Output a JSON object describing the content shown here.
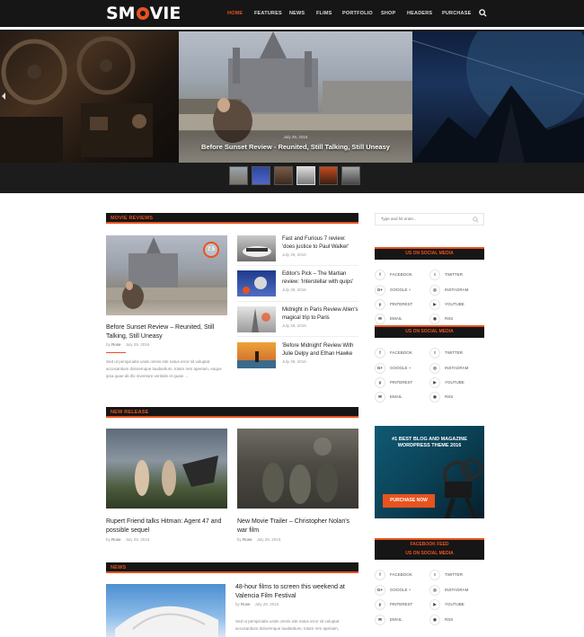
{
  "header": {
    "logo_left": "SM",
    "logo_right": "VIE",
    "nav": [
      "HOME",
      "FEATURES",
      "NEWS",
      "FLIMS",
      "PORTFOLIO",
      "SHOP",
      "HEADERS",
      "PURCHASE"
    ],
    "active_nav": "HOME",
    "search_icon": "search-icon"
  },
  "hero": {
    "date": "July 29, 2016",
    "title": "Before Sunset Review - Reunited, Still Talking, Still Uneasy"
  },
  "movie_reviews": {
    "heading": "MOVIE REVIEWS",
    "featured": {
      "title": "Before Sunset Review – Reunited, Still Talking, Still Uneasy",
      "author_prefix": "by",
      "author": "Rose",
      "date": "July 29, 2016",
      "rating": "7.5",
      "excerpt": "Sed ut perspiciatis unde omnis iste natus error sit voluptat accusantium doloremque laudantium, totam rem aperiam, eaque ipsa quae ab illo inventore veritatis et quasi …"
    },
    "list": [
      {
        "title": "Fast and Furious 7 review: 'does justice to Paul Walker'",
        "date": "July 29, 2016"
      },
      {
        "title": "Editor's Pick – The Martian review: 'Interstellar with quips'",
        "date": "July 29, 2016"
      },
      {
        "title": "Midnight in Paris Review Allen's magical trip to Paris",
        "date": "July 29, 2016"
      },
      {
        "title": "'Before Midnight' Review With Julie Delpy and Ethan Hawke",
        "date": "July 29, 2016"
      }
    ]
  },
  "new_release": {
    "heading": "NEW RELEASE",
    "items": [
      {
        "title": "Rupert Friend talks Hitman: Agent 47 and possible sequel",
        "author": "Rose",
        "date": "July 29, 2016"
      },
      {
        "title": "New Movie Trailer – Christopher Nolan's war film",
        "author": "Rose",
        "date": "July 29, 2016"
      }
    ]
  },
  "news": {
    "heading": "NEWS",
    "item": {
      "title": "48-hour films to screen this weekend at Valencia Film Festival",
      "author": "Rose",
      "date": "July 29, 2016",
      "excerpt": "Sed ut perspiciatis unde omnis iste natus error sit voluptat accusantium doloremque laudantium, totam rem aperiam,"
    }
  },
  "sidebar": {
    "search_placeholder": "Type and hit enter...",
    "social_heading": "US ON SOCIAL MEDIA",
    "social_left": [
      "FACEBOOK",
      "GOOGLE +",
      "PINTEREST",
      "EMAIL"
    ],
    "social_right": [
      "TWITTER",
      "INSTAGRAM",
      "YOUTUBE",
      "RSS"
    ],
    "promo": {
      "line1": "#1 BEST BLOG AND MAGAZINE",
      "line2": "WORDPRESS THEME 2016",
      "button": "PURCHASE NOW"
    },
    "feed_heading": "FACEBOOK FEED"
  },
  "colors": {
    "accent": "#e8531e",
    "dark": "#161616"
  }
}
